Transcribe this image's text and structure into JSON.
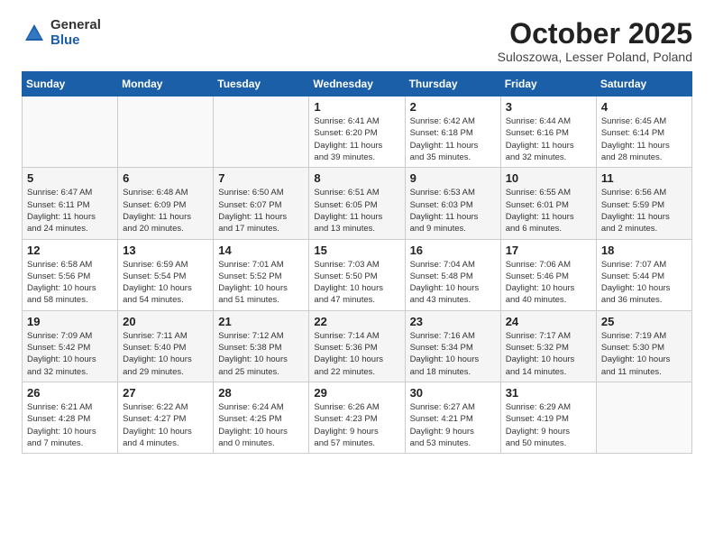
{
  "header": {
    "logo_general": "General",
    "logo_blue": "Blue",
    "title": "October 2025",
    "subtitle": "Suloszowa, Lesser Poland, Poland"
  },
  "weekdays": [
    "Sunday",
    "Monday",
    "Tuesday",
    "Wednesday",
    "Thursday",
    "Friday",
    "Saturday"
  ],
  "weeks": [
    [
      {
        "day": "",
        "info": ""
      },
      {
        "day": "",
        "info": ""
      },
      {
        "day": "",
        "info": ""
      },
      {
        "day": "1",
        "info": "Sunrise: 6:41 AM\nSunset: 6:20 PM\nDaylight: 11 hours\nand 39 minutes."
      },
      {
        "day": "2",
        "info": "Sunrise: 6:42 AM\nSunset: 6:18 PM\nDaylight: 11 hours\nand 35 minutes."
      },
      {
        "day": "3",
        "info": "Sunrise: 6:44 AM\nSunset: 6:16 PM\nDaylight: 11 hours\nand 32 minutes."
      },
      {
        "day": "4",
        "info": "Sunrise: 6:45 AM\nSunset: 6:14 PM\nDaylight: 11 hours\nand 28 minutes."
      }
    ],
    [
      {
        "day": "5",
        "info": "Sunrise: 6:47 AM\nSunset: 6:11 PM\nDaylight: 11 hours\nand 24 minutes."
      },
      {
        "day": "6",
        "info": "Sunrise: 6:48 AM\nSunset: 6:09 PM\nDaylight: 11 hours\nand 20 minutes."
      },
      {
        "day": "7",
        "info": "Sunrise: 6:50 AM\nSunset: 6:07 PM\nDaylight: 11 hours\nand 17 minutes."
      },
      {
        "day": "8",
        "info": "Sunrise: 6:51 AM\nSunset: 6:05 PM\nDaylight: 11 hours\nand 13 minutes."
      },
      {
        "day": "9",
        "info": "Sunrise: 6:53 AM\nSunset: 6:03 PM\nDaylight: 11 hours\nand 9 minutes."
      },
      {
        "day": "10",
        "info": "Sunrise: 6:55 AM\nSunset: 6:01 PM\nDaylight: 11 hours\nand 6 minutes."
      },
      {
        "day": "11",
        "info": "Sunrise: 6:56 AM\nSunset: 5:59 PM\nDaylight: 11 hours\nand 2 minutes."
      }
    ],
    [
      {
        "day": "12",
        "info": "Sunrise: 6:58 AM\nSunset: 5:56 PM\nDaylight: 10 hours\nand 58 minutes."
      },
      {
        "day": "13",
        "info": "Sunrise: 6:59 AM\nSunset: 5:54 PM\nDaylight: 10 hours\nand 54 minutes."
      },
      {
        "day": "14",
        "info": "Sunrise: 7:01 AM\nSunset: 5:52 PM\nDaylight: 10 hours\nand 51 minutes."
      },
      {
        "day": "15",
        "info": "Sunrise: 7:03 AM\nSunset: 5:50 PM\nDaylight: 10 hours\nand 47 minutes."
      },
      {
        "day": "16",
        "info": "Sunrise: 7:04 AM\nSunset: 5:48 PM\nDaylight: 10 hours\nand 43 minutes."
      },
      {
        "day": "17",
        "info": "Sunrise: 7:06 AM\nSunset: 5:46 PM\nDaylight: 10 hours\nand 40 minutes."
      },
      {
        "day": "18",
        "info": "Sunrise: 7:07 AM\nSunset: 5:44 PM\nDaylight: 10 hours\nand 36 minutes."
      }
    ],
    [
      {
        "day": "19",
        "info": "Sunrise: 7:09 AM\nSunset: 5:42 PM\nDaylight: 10 hours\nand 32 minutes."
      },
      {
        "day": "20",
        "info": "Sunrise: 7:11 AM\nSunset: 5:40 PM\nDaylight: 10 hours\nand 29 minutes."
      },
      {
        "day": "21",
        "info": "Sunrise: 7:12 AM\nSunset: 5:38 PM\nDaylight: 10 hours\nand 25 minutes."
      },
      {
        "day": "22",
        "info": "Sunrise: 7:14 AM\nSunset: 5:36 PM\nDaylight: 10 hours\nand 22 minutes."
      },
      {
        "day": "23",
        "info": "Sunrise: 7:16 AM\nSunset: 5:34 PM\nDaylight: 10 hours\nand 18 minutes."
      },
      {
        "day": "24",
        "info": "Sunrise: 7:17 AM\nSunset: 5:32 PM\nDaylight: 10 hours\nand 14 minutes."
      },
      {
        "day": "25",
        "info": "Sunrise: 7:19 AM\nSunset: 5:30 PM\nDaylight: 10 hours\nand 11 minutes."
      }
    ],
    [
      {
        "day": "26",
        "info": "Sunrise: 6:21 AM\nSunset: 4:28 PM\nDaylight: 10 hours\nand 7 minutes."
      },
      {
        "day": "27",
        "info": "Sunrise: 6:22 AM\nSunset: 4:27 PM\nDaylight: 10 hours\nand 4 minutes."
      },
      {
        "day": "28",
        "info": "Sunrise: 6:24 AM\nSunset: 4:25 PM\nDaylight: 10 hours\nand 0 minutes."
      },
      {
        "day": "29",
        "info": "Sunrise: 6:26 AM\nSunset: 4:23 PM\nDaylight: 9 hours\nand 57 minutes."
      },
      {
        "day": "30",
        "info": "Sunrise: 6:27 AM\nSunset: 4:21 PM\nDaylight: 9 hours\nand 53 minutes."
      },
      {
        "day": "31",
        "info": "Sunrise: 6:29 AM\nSunset: 4:19 PM\nDaylight: 9 hours\nand 50 minutes."
      },
      {
        "day": "",
        "info": ""
      }
    ]
  ]
}
